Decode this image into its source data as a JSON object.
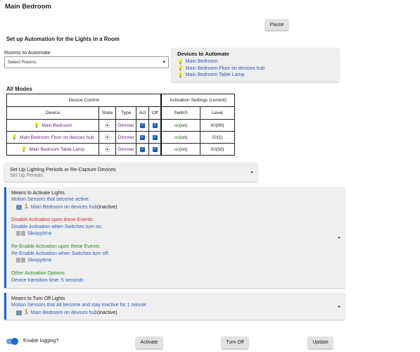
{
  "page": {
    "title": "Main Bedroom"
  },
  "buttons": {
    "pause": "Pause",
    "activate": "Activate",
    "turn_off": "Turn Off",
    "update": "Update"
  },
  "setup": {
    "heading": "Set up Automation for the Lights in a Room",
    "rooms_label": "Rooms to Automate",
    "rooms_select": "Select Rooms"
  },
  "devices_box": {
    "title": "Devices to Automate",
    "items": [
      "Main Bedroom",
      "Main Bedroom Floor on devices hub",
      "Main Bedroom Table Lamp"
    ]
  },
  "modes": {
    "label": "All Modes",
    "group_device_control": "Device Control",
    "group_activation": "Activation Settings (current)",
    "headers": [
      "Device",
      "State",
      "Type",
      "Act",
      "Off",
      "Switch",
      "Level"
    ],
    "rows": [
      {
        "device": "Main Bedroom",
        "type": "Dimmer",
        "switch_on": "on",
        "switch_cur": "(on)",
        "level": "80",
        "level_cur": "(80)"
      },
      {
        "device": "Main Bedroom Floor on devices hub",
        "type": "Dimmer",
        "switch_on": "on",
        "switch_cur": "(on)",
        "level": "50",
        "level_cur": "(1)"
      },
      {
        "device": "Main Bedroom Table Lamp",
        "type": "Dimmer",
        "switch_on": "on",
        "switch_cur": "(on)",
        "level": "50",
        "level_cur": "(50)"
      }
    ]
  },
  "periods": {
    "title": "Set Up Lighting Periods or Re-Capture Devices",
    "subtitle": "Set Up Periods"
  },
  "activate_panel": {
    "title": "Means to Activate Lights",
    "motion_label": "Motion Sensors that become active:",
    "motion_device": "Main Bedroom on devices hub",
    "motion_state": "(inactive)",
    "disable_heading": "Disable Activation upon these Events:",
    "disable_switch_label": "Disable Activation when Switches turn on:",
    "disable_switch": "Sleepytime",
    "reenable_heading": "Re-Enable Activation upon these Events:",
    "reenable_switch_label": "Re-Enable Activation when Switches turn off:",
    "reenable_switch": "Sleepytime",
    "other_heading": "Other Activation Options:",
    "transition": "Device transition time: 5 seconds"
  },
  "off_panel": {
    "title": "Means to Turn Off Lights",
    "motion_label": "Motion Sensors that All become and stay inactive for 1 minute:",
    "motion_device": "Main Bedroom on devices hub",
    "motion_state": "(inactive)"
  },
  "logging": {
    "label": "Enable logging?",
    "enabled": true
  },
  "colors": {
    "accent": "#1e66c9",
    "link": "#2f5bb7",
    "purple": "#6a1b7a",
    "green": "#2e7d32",
    "red": "#d32f2f"
  }
}
